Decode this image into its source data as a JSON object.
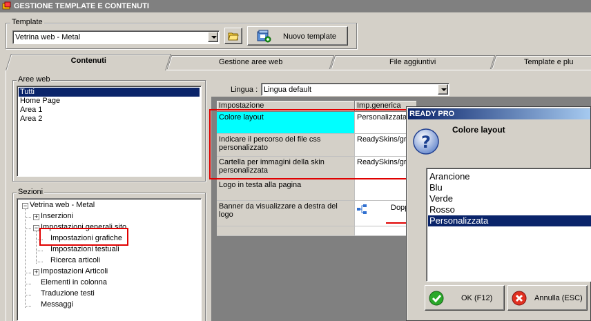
{
  "window": {
    "title": "GESTIONE TEMPLATE E CONTENUTI"
  },
  "template": {
    "group_label": "Template",
    "selected": "Vetrina web - Metal",
    "new_button": "Nuovo template"
  },
  "tabs": [
    {
      "label": "Contenuti",
      "active": true
    },
    {
      "label": "Gestione aree web",
      "active": false
    },
    {
      "label": "File aggiuntivi",
      "active": false
    },
    {
      "label": "Template e plu",
      "active": false
    }
  ],
  "aree_web": {
    "label": "Aree web",
    "items": [
      {
        "label": "Tutti",
        "selected": true
      },
      {
        "label": "Home Page",
        "selected": false
      },
      {
        "label": "Area 1",
        "selected": false
      },
      {
        "label": "Area 2",
        "selected": false
      }
    ]
  },
  "sezioni": {
    "label": "Sezioni",
    "tree": [
      {
        "label": "Vetrina web - Metal",
        "expander": "−"
      },
      {
        "label": "Inserzioni",
        "expander": "+"
      },
      {
        "label": "Impostazioni generali sito",
        "expander": "−"
      },
      {
        "label": "Impostazioni grafiche"
      },
      {
        "label": "Impostazioni testuali"
      },
      {
        "label": "Ricerca articoli"
      },
      {
        "label": "Impostazioni Articoli",
        "expander": "+"
      },
      {
        "label": "Elementi in colonna"
      },
      {
        "label": "Traduzione testi"
      },
      {
        "label": "Messaggi"
      }
    ]
  },
  "lingua": {
    "label": "Lingua :",
    "selected": "Lingua default"
  },
  "grid": {
    "headers": [
      "Impostazione",
      "Imp.generica"
    ],
    "rows": [
      {
        "setting": "Colore layout",
        "value": "Personalizzata"
      },
      {
        "setting": "Indicare il percorso del file css personalizzato",
        "value": "ReadySkins/gr"
      },
      {
        "setting": "Cartella per immagini della skin personalizzata",
        "value": "ReadySkins/gr"
      },
      {
        "setting": "Logo in testa alla pagina",
        "value": ""
      },
      {
        "setting": "Banner da visualizzare a destra del logo",
        "value": "Dopp"
      }
    ]
  },
  "dialog": {
    "title": "READY PRO",
    "heading": "Colore layout",
    "options": [
      {
        "label": "Arancione",
        "selected": false
      },
      {
        "label": "Blu",
        "selected": false
      },
      {
        "label": "Verde",
        "selected": false
      },
      {
        "label": "Rosso",
        "selected": false
      },
      {
        "label": "Personalizzata",
        "selected": true
      }
    ],
    "ok_label": "OK (F12)",
    "cancel_label": "Annulla (ESC)"
  },
  "colors": {
    "highlight": "#0a246a",
    "cyan_cell": "#00ffff",
    "annotation_red": "#e00000"
  }
}
